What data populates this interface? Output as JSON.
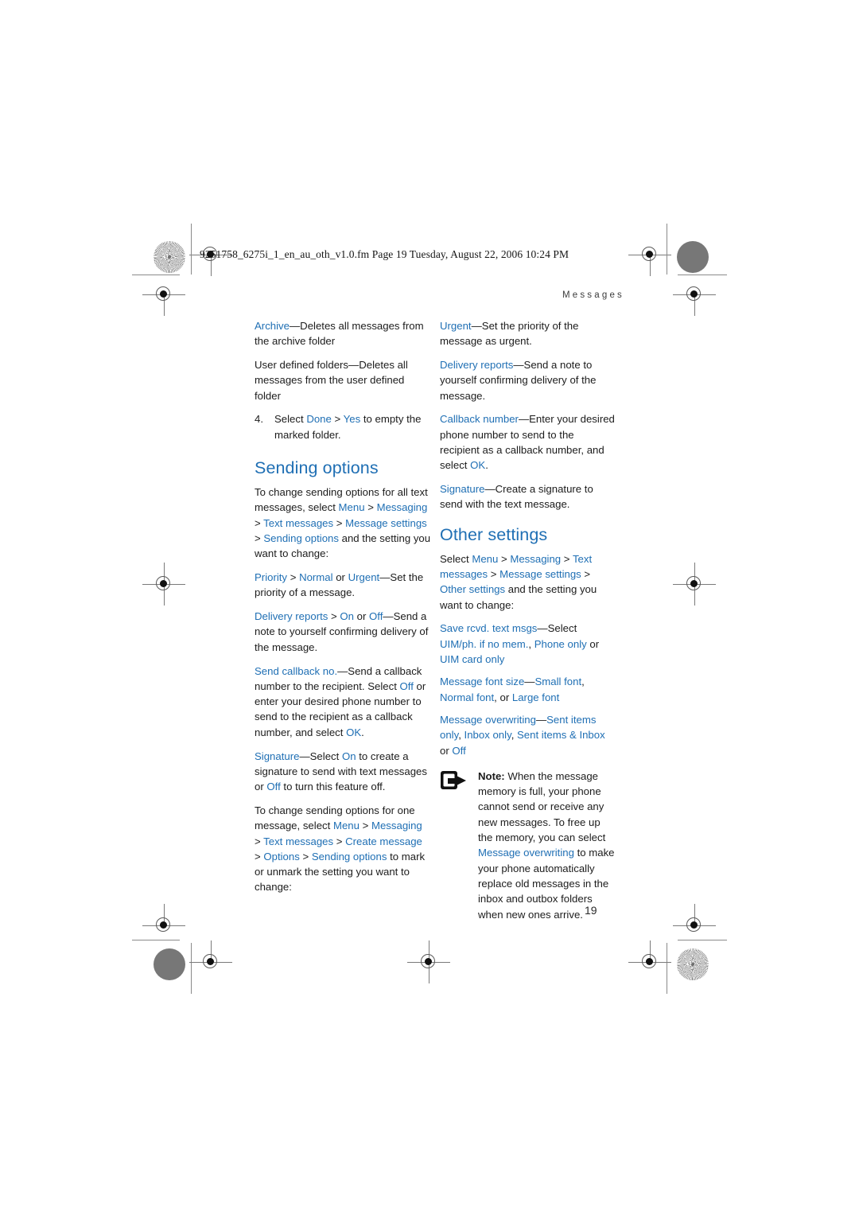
{
  "page": {
    "file_stamp": "9251758_6275i_1_en_au_oth_v1.0.fm  Page 19  Tuesday, August 22, 2006  10:24 PM",
    "chapter_header": "Messages",
    "folio": "19",
    "accent_color": "#1f6fb4",
    "text_color": "#1c1c1c",
    "background": "#ffffff"
  },
  "left_column": {
    "archive_item": {
      "term": "Archive",
      "dash": "—",
      "desc": "Deletes all messages from the archive folder"
    },
    "user_folders_item": {
      "text": "User defined folders—Deletes all messages from the user defined folder"
    },
    "step4": {
      "number": "4.",
      "lead": "Select ",
      "term1": "Done",
      "sep": " > ",
      "term2": "Yes",
      "tail": " to empty the marked folder."
    },
    "sending_options": {
      "heading": "Sending options",
      "intro_lead": "To change sending options for all text messages, select ",
      "path": [
        {
          "term": "Menu",
          "sep": " > "
        },
        {
          "term": "Messaging",
          "sep": " > "
        },
        {
          "term": "Text messages",
          "sep": " > "
        },
        {
          "term": "Message settings",
          "sep": " > "
        },
        {
          "term": "Sending options",
          "sep": ""
        }
      ],
      "intro_tail": " and the setting you want to change:",
      "items": [
        {
          "terms": [
            "Priority",
            "Normal",
            "Urgent"
          ],
          "seps": [
            " > ",
            " or "
          ],
          "dash": "—",
          "desc": "Set the priority of a message."
        },
        {
          "terms": [
            "Delivery reports",
            "On",
            "Off"
          ],
          "seps": [
            " > ",
            " or "
          ],
          "dash": "—",
          "desc": "Send a note to yourself confirming delivery of the message."
        },
        {
          "terms": [
            "Send callback no."
          ],
          "seps": [],
          "dash": "—",
          "desc_pre": "Send a callback number to the recipient. Select ",
          "desc_term1": "Off",
          "desc_mid": " or enter your desired phone number to send to the recipient as a callback number, and select ",
          "desc_term2": "OK",
          "desc_post": "."
        },
        {
          "terms": [
            "Signature"
          ],
          "seps": [],
          "dash": "—",
          "desc_pre": "Select ",
          "desc_term1": "On",
          "desc_mid": " to create a signature to send with text messages or ",
          "desc_term2": "Off",
          "desc_post": " to turn this feature off."
        }
      ],
      "one_message_lead": "To change sending options for one message, select ",
      "one_message_path": [
        {
          "term": "Menu",
          "sep": " > "
        },
        {
          "term": "Messaging",
          "sep": " > "
        },
        {
          "term": "Text messages",
          "sep": " > "
        },
        {
          "term": "Create message",
          "sep": " > "
        },
        {
          "term": "Options",
          "sep": " > "
        },
        {
          "term": "Sending options",
          "sep": ""
        }
      ],
      "one_message_tail": " to mark or unmark the setting you want to change:"
    }
  },
  "right_column": {
    "items": [
      {
        "terms": [
          "Urgent"
        ],
        "dash": "—",
        "desc": "Set the priority of the message as urgent."
      },
      {
        "terms": [
          "Delivery reports"
        ],
        "dash": "—",
        "desc": "Send a note to yourself confirming delivery of the message."
      }
    ],
    "callback": {
      "term": "Callback number",
      "dash": "—",
      "desc_pre": "Enter your desired phone number to send to the recipient as a callback number, and select ",
      "desc_term": "OK",
      "desc_post": "."
    },
    "signature": {
      "term": "Signature",
      "dash": "—",
      "desc": "Create a signature to send with the text message."
    },
    "other_settings": {
      "heading": "Other settings",
      "intro_lead": "Select ",
      "path": [
        {
          "term": "Menu",
          "sep": " > "
        },
        {
          "term": "Messaging",
          "sep": " > "
        },
        {
          "term": "Text messages",
          "sep": " > "
        },
        {
          "term": "Message settings",
          "sep": " > "
        },
        {
          "term": "Other settings",
          "sep": ""
        }
      ],
      "intro_tail": " and the setting you want to change:",
      "options": [
        {
          "term": "Save rcvd. text msgs",
          "dash": "—",
          "lead": "Select ",
          "values": [
            "UIM/ph. if no mem.",
            "Phone only",
            "UIM card only"
          ],
          "seps": [
            ", ",
            " or "
          ],
          "tail": ""
        },
        {
          "term": "Message font size",
          "dash": "—",
          "lead": "",
          "values": [
            "Small font",
            "Normal font",
            "Large font"
          ],
          "seps": [
            ", ",
            ", or "
          ],
          "tail": ""
        },
        {
          "term": "Message overwriting",
          "dash": "—",
          "lead": "",
          "values": [
            "Sent items only",
            "Inbox only",
            "Sent items & Inbox",
            "Off"
          ],
          "seps": [
            ", ",
            ", ",
            " or "
          ],
          "tail": ""
        }
      ]
    },
    "note": {
      "icon_name": "note-phone-arrow-icon",
      "label": "Note:",
      "text_pre": " When the message memory is full, your phone cannot send or receive any new messages. To free up the memory, you can select ",
      "term": "Message overwriting",
      "text_post": " to make your phone automatically replace old messages in the inbox and outbox folders when new ones arrive."
    }
  }
}
